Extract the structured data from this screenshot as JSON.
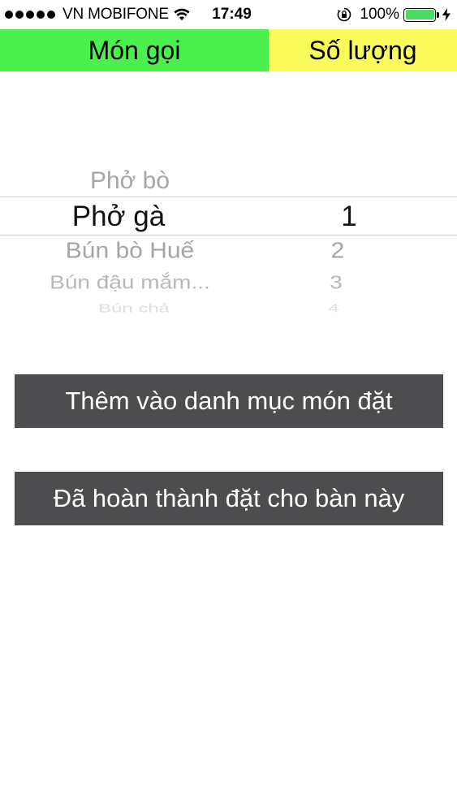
{
  "status_bar": {
    "carrier": "VN MOBIFONE",
    "time": "17:49",
    "battery": "100%",
    "icons": [
      "signal-dots",
      "wifi-icon",
      "rotation-lock-icon",
      "battery-icon",
      "charging-icon"
    ]
  },
  "header": {
    "dish_label": "Món gọi",
    "quantity_label": "Số lượng",
    "dish_color": "#4cf04c",
    "quantity_color": "#fbfb5c"
  },
  "picker": {
    "dishes": [
      "Phở bò",
      "Phở gà",
      "Bún bò Huế",
      "Bún đậu mắm...",
      "Bún chả"
    ],
    "selected_dish": "Phở gà",
    "quantities": [
      "1",
      "2",
      "3",
      "4"
    ],
    "selected_quantity": "1"
  },
  "buttons": {
    "add": "Thêm vào danh mục món đặt",
    "done": "Đã hoàn thành đặt cho bàn này",
    "color": "#4d4d4f"
  }
}
